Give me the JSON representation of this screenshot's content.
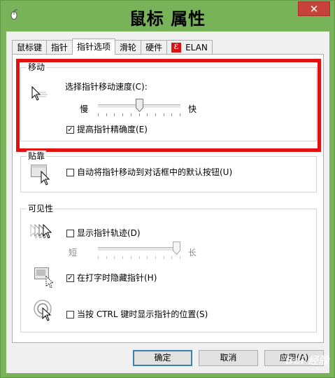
{
  "window": {
    "title": "鼠标 属性",
    "close_glyph": "✕"
  },
  "tabs": [
    {
      "label": "鼠标键"
    },
    {
      "label": "指针"
    },
    {
      "label": "指针选项",
      "active": true
    },
    {
      "label": "滑轮"
    },
    {
      "label": "硬件"
    },
    {
      "label": "ELAN",
      "logo": "ELAN"
    }
  ],
  "motion": {
    "group_label": "移动",
    "speed_label": "选择指针移动速度(C):",
    "slow_label": "慢",
    "fast_label": "快",
    "speed_value_fraction": 0.5,
    "precision_label": "提高指针精确度(E)",
    "precision_checked": true
  },
  "snap": {
    "group_label": "贴靠",
    "snap_label": "自动将指针移动到对话框中的默认按钮(U)",
    "snap_checked": false
  },
  "visibility": {
    "group_label": "可见性",
    "trails_label": "显示指针轨迹(D)",
    "trails_checked": false,
    "short_label": "短",
    "long_label": "长",
    "trails_value_fraction": 1.0,
    "hide_label": "在打字时隐藏指针(H)",
    "hide_checked": true,
    "ctrl_label": "当按 CTRL 键时显示指针的位置(S)",
    "ctrl_checked": false
  },
  "buttons": {
    "ok": "确定",
    "cancel": "取消",
    "apply": "应用(A)"
  },
  "watermark": "Bai 经验",
  "colors": {
    "highlight": "#e41010",
    "titlebar": "#78b35a",
    "close": "#c7433a"
  }
}
